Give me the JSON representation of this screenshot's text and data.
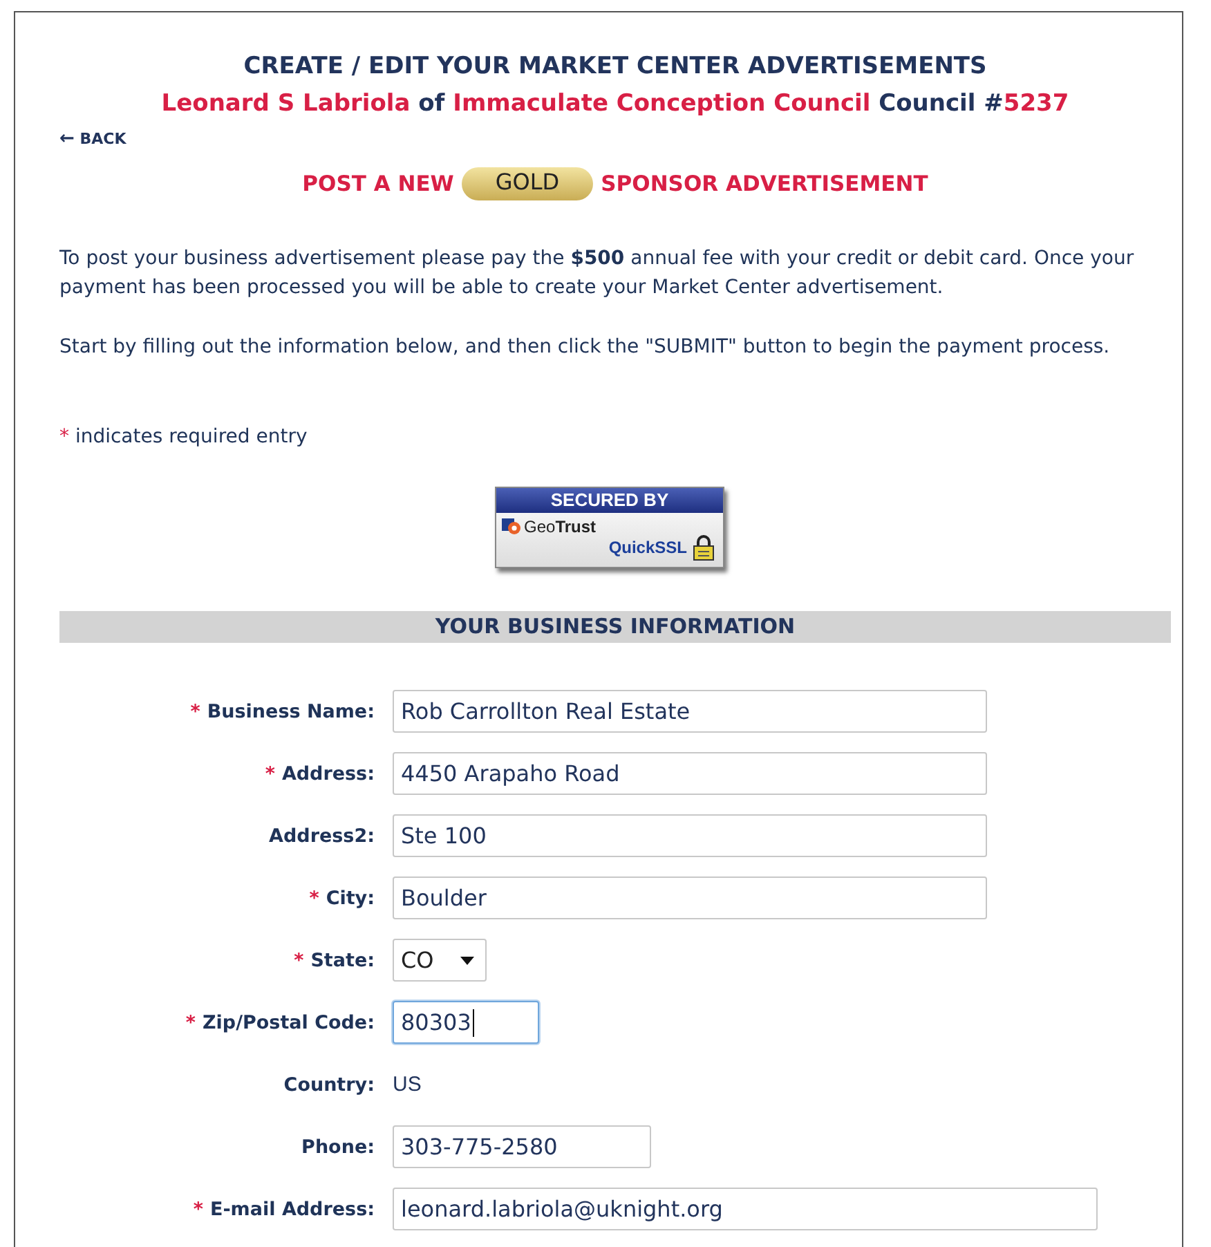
{
  "title": "CREATE / EDIT YOUR MARKET CENTER ADVERTISEMENTS",
  "subtitle": [
    {
      "text": "Leonard S Labriola ",
      "highlight": true
    },
    {
      "text": "of ",
      "highlight": false
    },
    {
      "text": "Immaculate Conception Council ",
      "highlight": true
    },
    {
      "text": "Council #",
      "highlight": false
    },
    {
      "text": "5237",
      "highlight": true
    }
  ],
  "back_link": {
    "icon": "←",
    "label": "BACK"
  },
  "post_line": {
    "before": "POST A NEW",
    "badge": "GOLD",
    "after": "SPONSOR ADVERTISEMENT"
  },
  "paragraphs": [
    "To post your business advertisement please pay the **$500** annual fee with your credit or debit card. Once your payment has been processed you will be able to create your Market Center advertisement.",
    "Start by filling out the information below, and then click the \"SUBMIT\" button to begin the payment process."
  ],
  "required_note": {
    "mark": "*",
    "text": "indicates required entry"
  },
  "seal": {
    "header": "SECURED BY",
    "brand": "Geo**Trust**",
    "product": "QuickSSL"
  },
  "section_title": "YOUR BUSINESS INFORMATION",
  "fields": [
    {
      "label": "Business Name:",
      "required": true,
      "kind": "text",
      "value": "Rob Carrollton Real Estate",
      "focused": false
    },
    {
      "label": "Address:",
      "required": true,
      "kind": "text",
      "value": "4450 Arapaho Road",
      "focused": false
    },
    {
      "label": "Address2:",
      "required": false,
      "kind": "text",
      "value": "Ste 100",
      "focused": false
    },
    {
      "label": "City:",
      "required": true,
      "kind": "text",
      "value": "Boulder",
      "focused": false
    },
    {
      "label": "State:",
      "required": true,
      "kind": "select",
      "value": "CO",
      "focused": false
    },
    {
      "label": "Zip/Postal Code:",
      "required": true,
      "kind": "text",
      "value": "80303",
      "focused": true
    },
    {
      "label": "Country:",
      "required": false,
      "kind": "static",
      "value": "US"
    },
    {
      "label": "Phone:",
      "required": false,
      "kind": "text",
      "value": "303-775-2580",
      "focused": false
    },
    {
      "label": "E-mail Address:",
      "required": true,
      "kind": "text",
      "value": "leonard.labriola@uknight.org",
      "focused": false
    }
  ]
}
